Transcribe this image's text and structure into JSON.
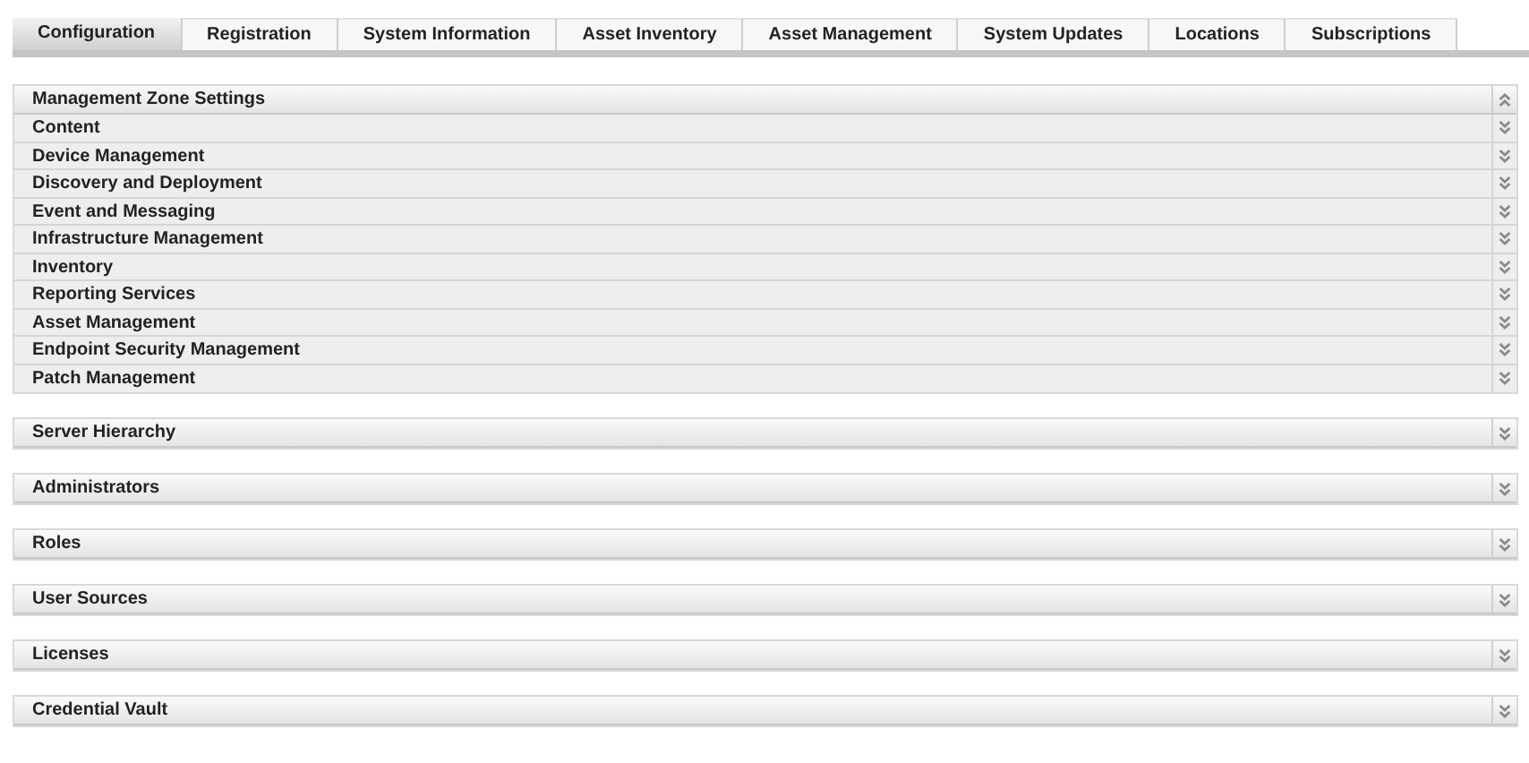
{
  "tabs": [
    {
      "label": "Configuration",
      "selected": true
    },
    {
      "label": "Registration",
      "selected": false
    },
    {
      "label": "System Information",
      "selected": false
    },
    {
      "label": "Asset Inventory",
      "selected": false
    },
    {
      "label": "Asset Management",
      "selected": false
    },
    {
      "label": "System Updates",
      "selected": false
    },
    {
      "label": "Locations",
      "selected": false
    },
    {
      "label": "Subscriptions",
      "selected": false
    }
  ],
  "panels": [
    {
      "title": "Management Zone Settings",
      "expanded": true,
      "items": [
        {
          "label": "Content",
          "expanded": false
        },
        {
          "label": "Device Management",
          "expanded": false
        },
        {
          "label": "Discovery and Deployment",
          "expanded": false
        },
        {
          "label": "Event and Messaging",
          "expanded": false
        },
        {
          "label": "Infrastructure Management",
          "expanded": false
        },
        {
          "label": "Inventory",
          "expanded": false
        },
        {
          "label": "Reporting Services",
          "expanded": false
        },
        {
          "label": "Asset Management",
          "expanded": false
        },
        {
          "label": "Endpoint Security Management",
          "expanded": false
        },
        {
          "label": "Patch Management",
          "expanded": false
        }
      ]
    },
    {
      "title": "Server Hierarchy",
      "expanded": false
    },
    {
      "title": "Administrators",
      "expanded": false
    },
    {
      "title": "Roles",
      "expanded": false
    },
    {
      "title": "User Sources",
      "expanded": false
    },
    {
      "title": "Licenses",
      "expanded": false
    },
    {
      "title": "Credential Vault",
      "expanded": false
    }
  ]
}
